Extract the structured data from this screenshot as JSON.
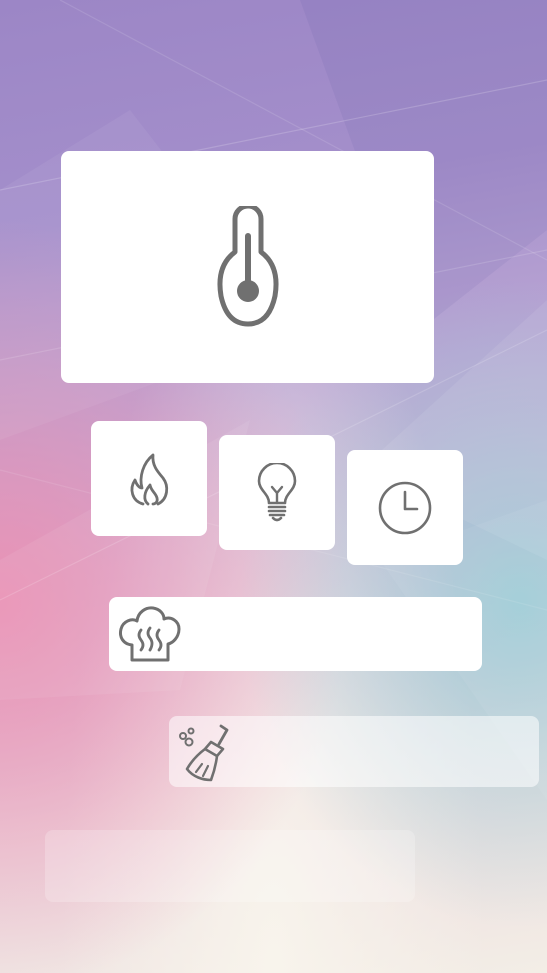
{
  "theme": {
    "tile_color": "#ffffff",
    "icon_color": "#707070",
    "background_colors": [
      "#9c86c6",
      "#ee8caf",
      "#8cd2d7",
      "#f3eee6"
    ]
  },
  "controls": {
    "temperature": {
      "icon": "thermometer-icon"
    },
    "heating": {
      "icon": "flame-icon"
    },
    "light": {
      "icon": "light-bulb-icon"
    },
    "timer": {
      "icon": "clock-icon"
    },
    "steam": {
      "icon": "steam-chef-hat-icon"
    },
    "cleaning": {
      "icon": "cleaning-brush-icon"
    }
  }
}
